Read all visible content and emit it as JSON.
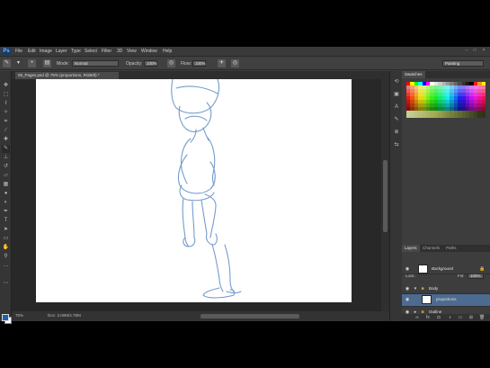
{
  "app": {
    "logo": "Ps",
    "menus": [
      "File",
      "Edit",
      "Image",
      "Layer",
      "Type",
      "Select",
      "Filter",
      "3D",
      "View",
      "Window",
      "Help"
    ],
    "window_controls": [
      "–",
      "□",
      "×"
    ]
  },
  "options": {
    "mode_label": "Mode:",
    "mode_value": "Normal",
    "opacity_label": "Opacity:",
    "opacity_value": "100%",
    "flow_label": "Flow:",
    "flow_value": "100%",
    "workspace_value": "Painting"
  },
  "document": {
    "tab_title": "06_Pages.psd @ 75% (proportions, RGB/8) *",
    "close_glyph": "×"
  },
  "status": {
    "zoom": "75%",
    "doc_size": "Doc: 3.00M/4.78M"
  },
  "panels": {
    "top_tabs": [
      "Swatches"
    ],
    "layer_tabs": [
      "Layers",
      "Channels",
      "Paths"
    ],
    "blend_mode": "Normal",
    "opacity_label": "Opacity:",
    "opacity_value": "100%",
    "lock_label": "Lock:",
    "fill_label": "Fill:",
    "fill_value": "100%",
    "layers": [
      {
        "name": "Body",
        "kind": "group",
        "expanded": true
      },
      {
        "name": "proportions",
        "kind": "layer",
        "selected": true
      },
      {
        "name": "Outline",
        "kind": "group",
        "expanded": false
      },
      {
        "name": "Background",
        "kind": "layer",
        "locked": true
      }
    ]
  },
  "colors": {
    "foreground": "#1e5fb4",
    "background": "#ffffff",
    "sketch_stroke": "#4a7ab8",
    "selected_layer": "#4d6b91"
  },
  "tool_icons": [
    "move-icon",
    "marquee-icon",
    "lasso-icon",
    "quick-select-icon",
    "crop-icon",
    "eyedropper-icon",
    "healing-icon",
    "brush-icon",
    "clone-stamp-icon",
    "history-brush-icon",
    "eraser-icon",
    "gradient-icon",
    "blur-icon",
    "dodge-icon",
    "pen-icon",
    "type-icon",
    "path-select-icon",
    "shape-icon",
    "hand-icon",
    "zoom-icon"
  ]
}
